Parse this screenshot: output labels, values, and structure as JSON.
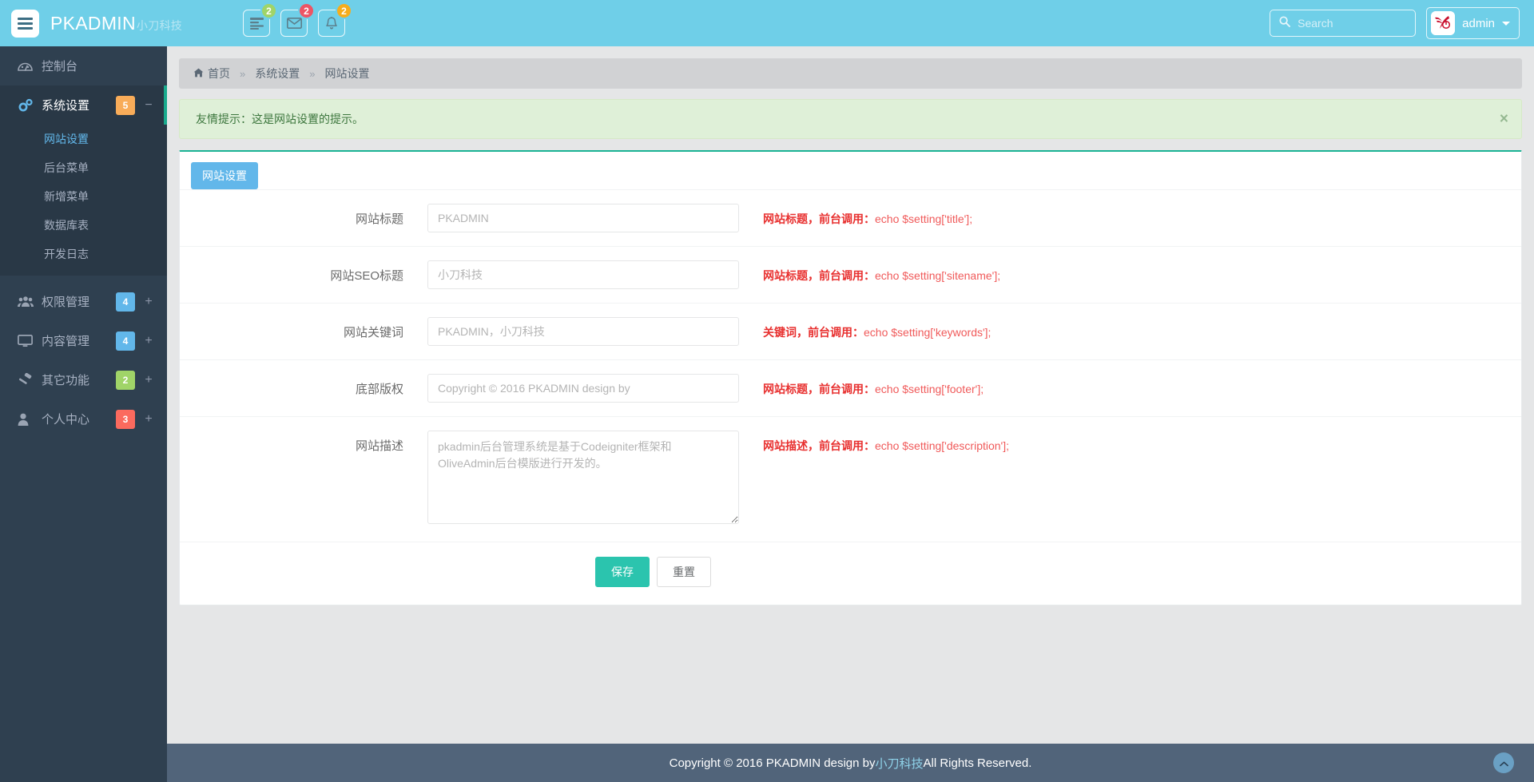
{
  "navbar": {
    "burger_icon": "hamburger-icon",
    "brand": "PKADMIN",
    "brand_sub": "小刀科技",
    "icons": [
      {
        "icon": "tasks-icon",
        "badge": "2",
        "color": "#a0d468"
      },
      {
        "icon": "envelope-icon",
        "badge": "2",
        "color": "#ed5565"
      },
      {
        "icon": "bell-icon",
        "badge": "2",
        "color": "#f6ad1c"
      }
    ],
    "search": {
      "placeholder": "Search",
      "value": "",
      "icon": "search-icon"
    },
    "user": {
      "name": "admin",
      "avatar": "user-logo-avatar",
      "caret": "caret-down-icon"
    }
  },
  "sidebar": {
    "dashboard": {
      "label": "控制台",
      "icon": "dashboard-icon"
    },
    "system": {
      "label": "系统设置",
      "icon": "gears-icon",
      "badge": "5",
      "badge_color": "#f8ac59",
      "toggle": "−",
      "children": [
        {
          "label": "网站设置",
          "active": true
        },
        {
          "label": "后台菜单",
          "active": false
        },
        {
          "label": "新增菜单",
          "active": false
        },
        {
          "label": "数据库表",
          "active": false
        },
        {
          "label": "开发日志",
          "active": false
        }
      ]
    },
    "items": [
      {
        "label": "权限管理",
        "icon": "users-icon",
        "badge": "4",
        "badge_color": "#62b7ea",
        "toggle": "+"
      },
      {
        "label": "内容管理",
        "icon": "desktop-icon",
        "badge": "4",
        "badge_color": "#62b7ea",
        "toggle": "+"
      },
      {
        "label": "其它功能",
        "icon": "hammer-icon",
        "badge": "2",
        "badge_color": "#a0d468",
        "toggle": "+"
      },
      {
        "label": "个人中心",
        "icon": "user-icon",
        "badge": "3",
        "badge_color": "#fb6a5e",
        "toggle": "+"
      }
    ]
  },
  "breadcrumb": {
    "home": "首页",
    "home_icon": "home-icon",
    "sep": "»",
    "level2": "系统设置",
    "level3": "网站设置"
  },
  "alert": {
    "text": "友情提示：这是网站设置的提示。",
    "close_icon": "close-icon",
    "close_label": "×"
  },
  "panel": {
    "tab_label": "网站设置",
    "fields": [
      {
        "label": "网站标题",
        "placeholder": "PKADMIN",
        "value": "",
        "help_bold": "网站标题，前台调用：",
        "help_code": "echo $setting['title'];",
        "type": "text"
      },
      {
        "label": "网站SEO标题",
        "placeholder": "小刀科技",
        "value": "",
        "help_bold": "网站标题，前台调用：",
        "help_code": "echo $setting['sitename'];",
        "type": "text"
      },
      {
        "label": "网站关键词",
        "placeholder": "PKADMIN，小刀科技",
        "value": "",
        "help_bold": "关键词，前台调用：",
        "help_code": "echo $setting['keywords'];",
        "type": "text"
      },
      {
        "label": "底部版权",
        "placeholder": "Copyright © 2016 PKADMIN design by",
        "value": "",
        "help_bold": "网站标题，前台调用：",
        "help_code": "echo $setting['footer'];",
        "type": "text"
      },
      {
        "label": "网站描述",
        "placeholder": "pkadmin后台管理系统是基于Codeigniter框架和OliveAdmin后台模版进行开发的。",
        "value": "",
        "help_bold": "网站描述，前台调用：",
        "help_code": "echo $setting['description'];",
        "type": "textarea"
      }
    ],
    "save_label": "保存",
    "reset_label": "重置"
  },
  "footer": {
    "text_before": "Copyright © 2016 PKADMIN design by ",
    "link": "小刀科技",
    "text_after": " All Rights Reserved.",
    "to_top_icon": "chevron-up-icon"
  }
}
